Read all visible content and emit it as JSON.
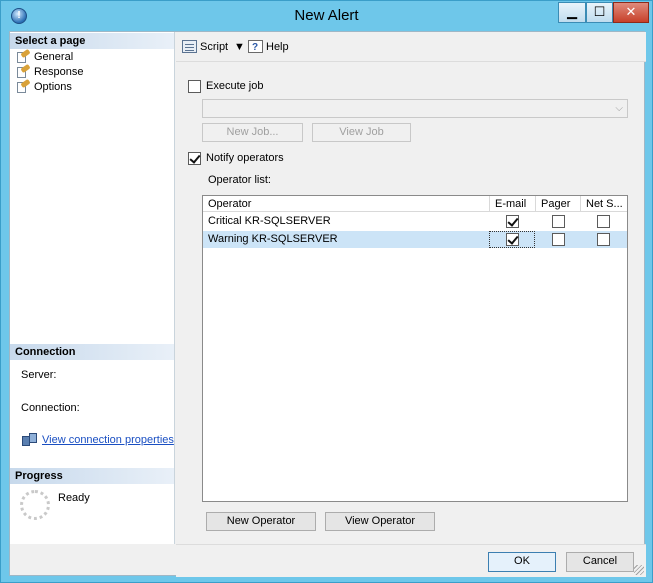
{
  "window": {
    "title": "New Alert",
    "icon": "sql-server-agent-icon",
    "controls": {
      "minimize": "▁",
      "maximize": "☐",
      "close": "✕"
    }
  },
  "left_pane": {
    "select_page_header": "Select a page",
    "pages": [
      {
        "label": "General",
        "icon": "page-wrench-icon"
      },
      {
        "label": "Response",
        "icon": "page-wrench-icon"
      },
      {
        "label": "Options",
        "icon": "page-wrench-icon"
      }
    ],
    "connection_header": "Connection",
    "server_label": "Server:",
    "connection_label": "Connection:",
    "view_connection_properties": "View connection properties",
    "progress_header": "Progress",
    "progress_status": "Ready"
  },
  "toolbar": {
    "script_label": "Script",
    "help_label": "Help"
  },
  "response": {
    "execute_job_label": "Execute job",
    "execute_job_checked": false,
    "job_combo_value": "",
    "new_job_button": "New Job...",
    "view_job_button": "View Job",
    "notify_operators_label": "Notify operators",
    "notify_operators_checked": true,
    "operator_list_label": "Operator list:",
    "columns": [
      "Operator",
      "E-mail",
      "Pager",
      "Net S..."
    ],
    "operators": [
      {
        "name": "Critical KR-SQLSERVER",
        "email": true,
        "pager": false,
        "net_send": false,
        "selected": false
      },
      {
        "name": "Warning KR-SQLSERVER",
        "email": true,
        "pager": false,
        "net_send": false,
        "selected": true
      }
    ],
    "new_operator_button": "New Operator",
    "view_operator_button": "View Operator"
  },
  "footer": {
    "ok_button": "OK",
    "cancel_button": "Cancel"
  },
  "colors": {
    "window_frame": "#6ec7ea",
    "selection": "#cce4f7",
    "link": "#1a4fc2"
  }
}
